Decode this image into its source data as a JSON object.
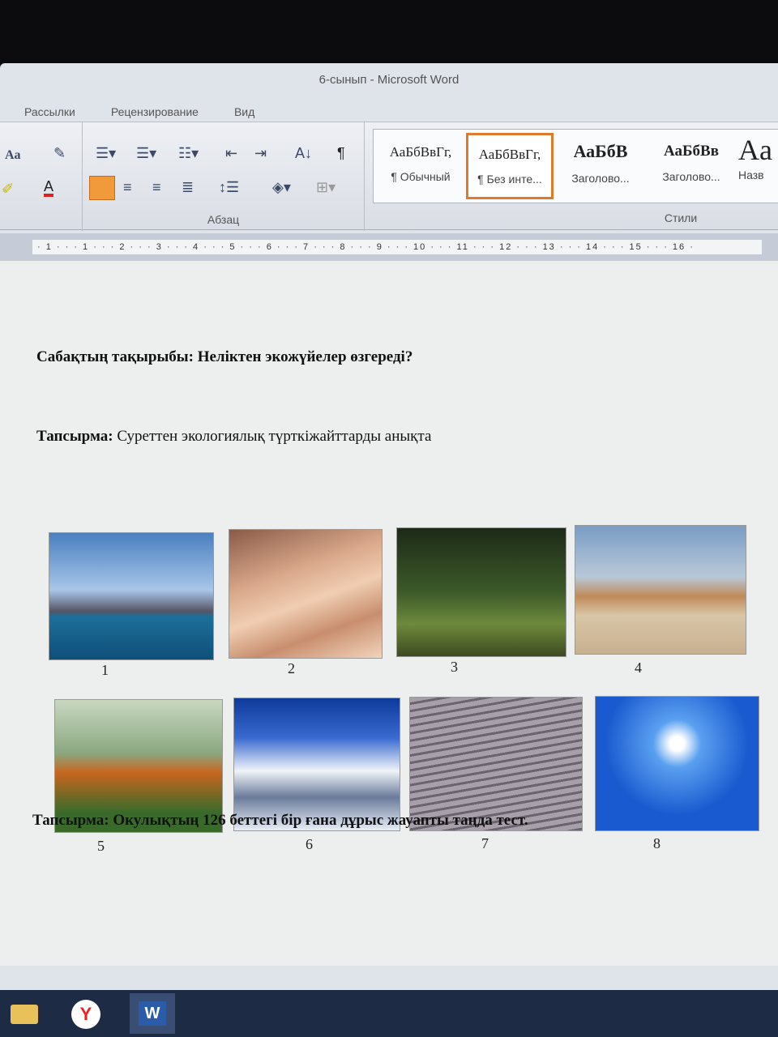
{
  "window": {
    "title": "6-сынып - Microsoft Word"
  },
  "tabs": [
    "Рассылки",
    "Рецензирование",
    "Вид"
  ],
  "ribbon": {
    "paragraph_label": "Абзац",
    "styles_label": "Стили",
    "font_case": "Aa",
    "styles": [
      {
        "sample": "АаБбВвГг,",
        "name": "¶ Обычный"
      },
      {
        "sample": "АаБбВвГг,",
        "name": "¶ Без инте..."
      },
      {
        "sample": "АаБбВ",
        "name": "Заголово..."
      },
      {
        "sample": "АаБбВв",
        "name": "Заголово..."
      },
      {
        "sample": "Aa",
        "name": "Назв"
      }
    ]
  },
  "ruler": "· 1 · · · 1 · · · 2 · · · 3 · · · 4 · · · 5 · · · 6 · · · 7 · · · 8 · · · 9 · · · 10 · · · 11 · · · 12 · · · 13 · · · 14 · · · 15 · · · 16 ·",
  "document": {
    "topic_label": "Сабақтың тақырыбы: Неліктен экожүйелер өзгереді?",
    "task1_label": "Тапсырма:",
    "task1_text": " Суреттен экологиялық түрткіжайттарды анықта",
    "images": [
      {
        "num": "1",
        "subject": "factory"
      },
      {
        "num": "2",
        "subject": "desert"
      },
      {
        "num": "3",
        "subject": "forest"
      },
      {
        "num": "4",
        "subject": "camel"
      },
      {
        "num": "5",
        "subject": "tiger"
      },
      {
        "num": "6",
        "subject": "mountain"
      },
      {
        "num": "7",
        "subject": "sand"
      },
      {
        "num": "8",
        "subject": "sky"
      }
    ],
    "task2": "Тапсырма: Окулықтың 126 беттегі бір ғана дұрыс жауапты таңда тест."
  },
  "taskbar": [
    {
      "icon": "folder-icon"
    },
    {
      "icon": "yandex-browser-icon",
      "label": "Y"
    },
    {
      "icon": "word-icon",
      "label": "W"
    }
  ]
}
